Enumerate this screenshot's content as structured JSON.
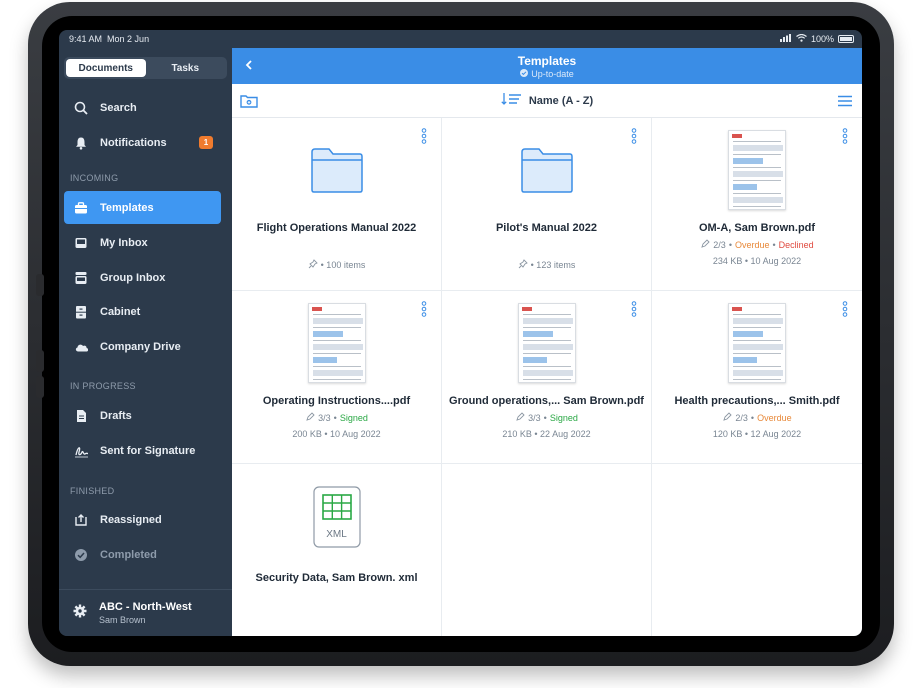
{
  "status": {
    "time": "9:41 AM",
    "date": "Mon 2 Jun",
    "battery": "100%"
  },
  "sidebar": {
    "tabs": [
      "Documents",
      "Tasks"
    ],
    "search": "Search",
    "notifications": {
      "label": "Notifications",
      "count": "1"
    },
    "section_incoming": "INCOMING",
    "incoming": [
      "Templates",
      "My Inbox",
      "Group Inbox",
      "Cabinet",
      "Company Drive"
    ],
    "section_progress": "IN PROGRESS",
    "progress": [
      "Drafts",
      "Sent for Signature"
    ],
    "section_finished": "FINISHED",
    "finished": [
      "Reassigned",
      "Completed"
    ],
    "account": {
      "name": "ABC - North-West",
      "user": "Sam Brown"
    }
  },
  "main": {
    "title": "Templates",
    "subtitle": "Up-to-date",
    "sort_label": "Name (A - Z)"
  },
  "items": [
    {
      "title": "Flight Operations Manual 2022",
      "meta": "• 100 items"
    },
    {
      "title": "Pilot's Manual 2022",
      "meta": "• 123 items"
    },
    {
      "title": "OM-A, Sam Brown.pdf",
      "progress": "2/3",
      "status1": "Overdue",
      "status2": "Declined",
      "size": "234 KB • 10 Aug 2022"
    },
    {
      "title": "Operating Instructions....pdf",
      "progress": "3/3",
      "status1": "Signed",
      "size": "200 KB • 10 Aug 2022"
    },
    {
      "title": "Ground operations,... Sam Brown.pdf",
      "progress": "3/3",
      "status1": "Signed",
      "size": "210 KB • 22 Aug 2022"
    },
    {
      "title": "Health precautions,... Smith.pdf",
      "progress": "2/3",
      "status1": "Overdue",
      "size": "120 KB • 12 Aug 2022"
    },
    {
      "title": "Security Data, Sam Brown. xml",
      "badge": "XML"
    }
  ],
  "colors": {
    "accent": "#3a8de6",
    "sidebar": "#2c3a4b",
    "signed": "#2aa845",
    "overdue": "#e8893a",
    "declined": "#e04a3f"
  }
}
